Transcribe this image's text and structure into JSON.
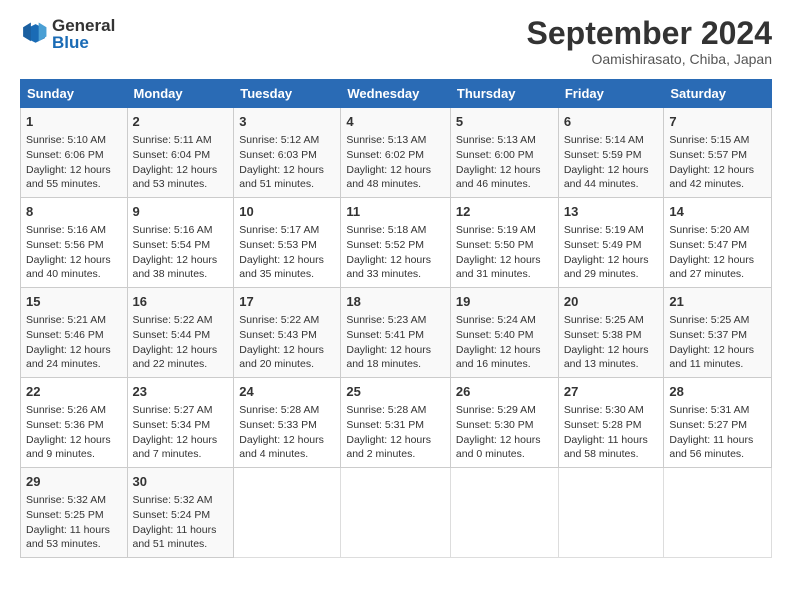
{
  "logo": {
    "line1": "General",
    "line2": "Blue"
  },
  "title": "September 2024",
  "subtitle": "Oamishirasato, Chiba, Japan",
  "weekdays": [
    "Sunday",
    "Monday",
    "Tuesday",
    "Wednesday",
    "Thursday",
    "Friday",
    "Saturday"
  ],
  "weeks": [
    [
      {
        "day": "1",
        "sunrise": "5:10 AM",
        "sunset": "6:06 PM",
        "daylight": "12 hours and 55 minutes."
      },
      {
        "day": "2",
        "sunrise": "5:11 AM",
        "sunset": "6:04 PM",
        "daylight": "12 hours and 53 minutes."
      },
      {
        "day": "3",
        "sunrise": "5:12 AM",
        "sunset": "6:03 PM",
        "daylight": "12 hours and 51 minutes."
      },
      {
        "day": "4",
        "sunrise": "5:13 AM",
        "sunset": "6:02 PM",
        "daylight": "12 hours and 48 minutes."
      },
      {
        "day": "5",
        "sunrise": "5:13 AM",
        "sunset": "6:00 PM",
        "daylight": "12 hours and 46 minutes."
      },
      {
        "day": "6",
        "sunrise": "5:14 AM",
        "sunset": "5:59 PM",
        "daylight": "12 hours and 44 minutes."
      },
      {
        "day": "7",
        "sunrise": "5:15 AM",
        "sunset": "5:57 PM",
        "daylight": "12 hours and 42 minutes."
      }
    ],
    [
      {
        "day": "8",
        "sunrise": "5:16 AM",
        "sunset": "5:56 PM",
        "daylight": "12 hours and 40 minutes."
      },
      {
        "day": "9",
        "sunrise": "5:16 AM",
        "sunset": "5:54 PM",
        "daylight": "12 hours and 38 minutes."
      },
      {
        "day": "10",
        "sunrise": "5:17 AM",
        "sunset": "5:53 PM",
        "daylight": "12 hours and 35 minutes."
      },
      {
        "day": "11",
        "sunrise": "5:18 AM",
        "sunset": "5:52 PM",
        "daylight": "12 hours and 33 minutes."
      },
      {
        "day": "12",
        "sunrise": "5:19 AM",
        "sunset": "5:50 PM",
        "daylight": "12 hours and 31 minutes."
      },
      {
        "day": "13",
        "sunrise": "5:19 AM",
        "sunset": "5:49 PM",
        "daylight": "12 hours and 29 minutes."
      },
      {
        "day": "14",
        "sunrise": "5:20 AM",
        "sunset": "5:47 PM",
        "daylight": "12 hours and 27 minutes."
      }
    ],
    [
      {
        "day": "15",
        "sunrise": "5:21 AM",
        "sunset": "5:46 PM",
        "daylight": "12 hours and 24 minutes."
      },
      {
        "day": "16",
        "sunrise": "5:22 AM",
        "sunset": "5:44 PM",
        "daylight": "12 hours and 22 minutes."
      },
      {
        "day": "17",
        "sunrise": "5:22 AM",
        "sunset": "5:43 PM",
        "daylight": "12 hours and 20 minutes."
      },
      {
        "day": "18",
        "sunrise": "5:23 AM",
        "sunset": "5:41 PM",
        "daylight": "12 hours and 18 minutes."
      },
      {
        "day": "19",
        "sunrise": "5:24 AM",
        "sunset": "5:40 PM",
        "daylight": "12 hours and 16 minutes."
      },
      {
        "day": "20",
        "sunrise": "5:25 AM",
        "sunset": "5:38 PM",
        "daylight": "12 hours and 13 minutes."
      },
      {
        "day": "21",
        "sunrise": "5:25 AM",
        "sunset": "5:37 PM",
        "daylight": "12 hours and 11 minutes."
      }
    ],
    [
      {
        "day": "22",
        "sunrise": "5:26 AM",
        "sunset": "5:36 PM",
        "daylight": "12 hours and 9 minutes."
      },
      {
        "day": "23",
        "sunrise": "5:27 AM",
        "sunset": "5:34 PM",
        "daylight": "12 hours and 7 minutes."
      },
      {
        "day": "24",
        "sunrise": "5:28 AM",
        "sunset": "5:33 PM",
        "daylight": "12 hours and 4 minutes."
      },
      {
        "day": "25",
        "sunrise": "5:28 AM",
        "sunset": "5:31 PM",
        "daylight": "12 hours and 2 minutes."
      },
      {
        "day": "26",
        "sunrise": "5:29 AM",
        "sunset": "5:30 PM",
        "daylight": "12 hours and 0 minutes."
      },
      {
        "day": "27",
        "sunrise": "5:30 AM",
        "sunset": "5:28 PM",
        "daylight": "11 hours and 58 minutes."
      },
      {
        "day": "28",
        "sunrise": "5:31 AM",
        "sunset": "5:27 PM",
        "daylight": "11 hours and 56 minutes."
      }
    ],
    [
      {
        "day": "29",
        "sunrise": "5:32 AM",
        "sunset": "5:25 PM",
        "daylight": "11 hours and 53 minutes."
      },
      {
        "day": "30",
        "sunrise": "5:32 AM",
        "sunset": "5:24 PM",
        "daylight": "11 hours and 51 minutes."
      },
      null,
      null,
      null,
      null,
      null
    ]
  ]
}
